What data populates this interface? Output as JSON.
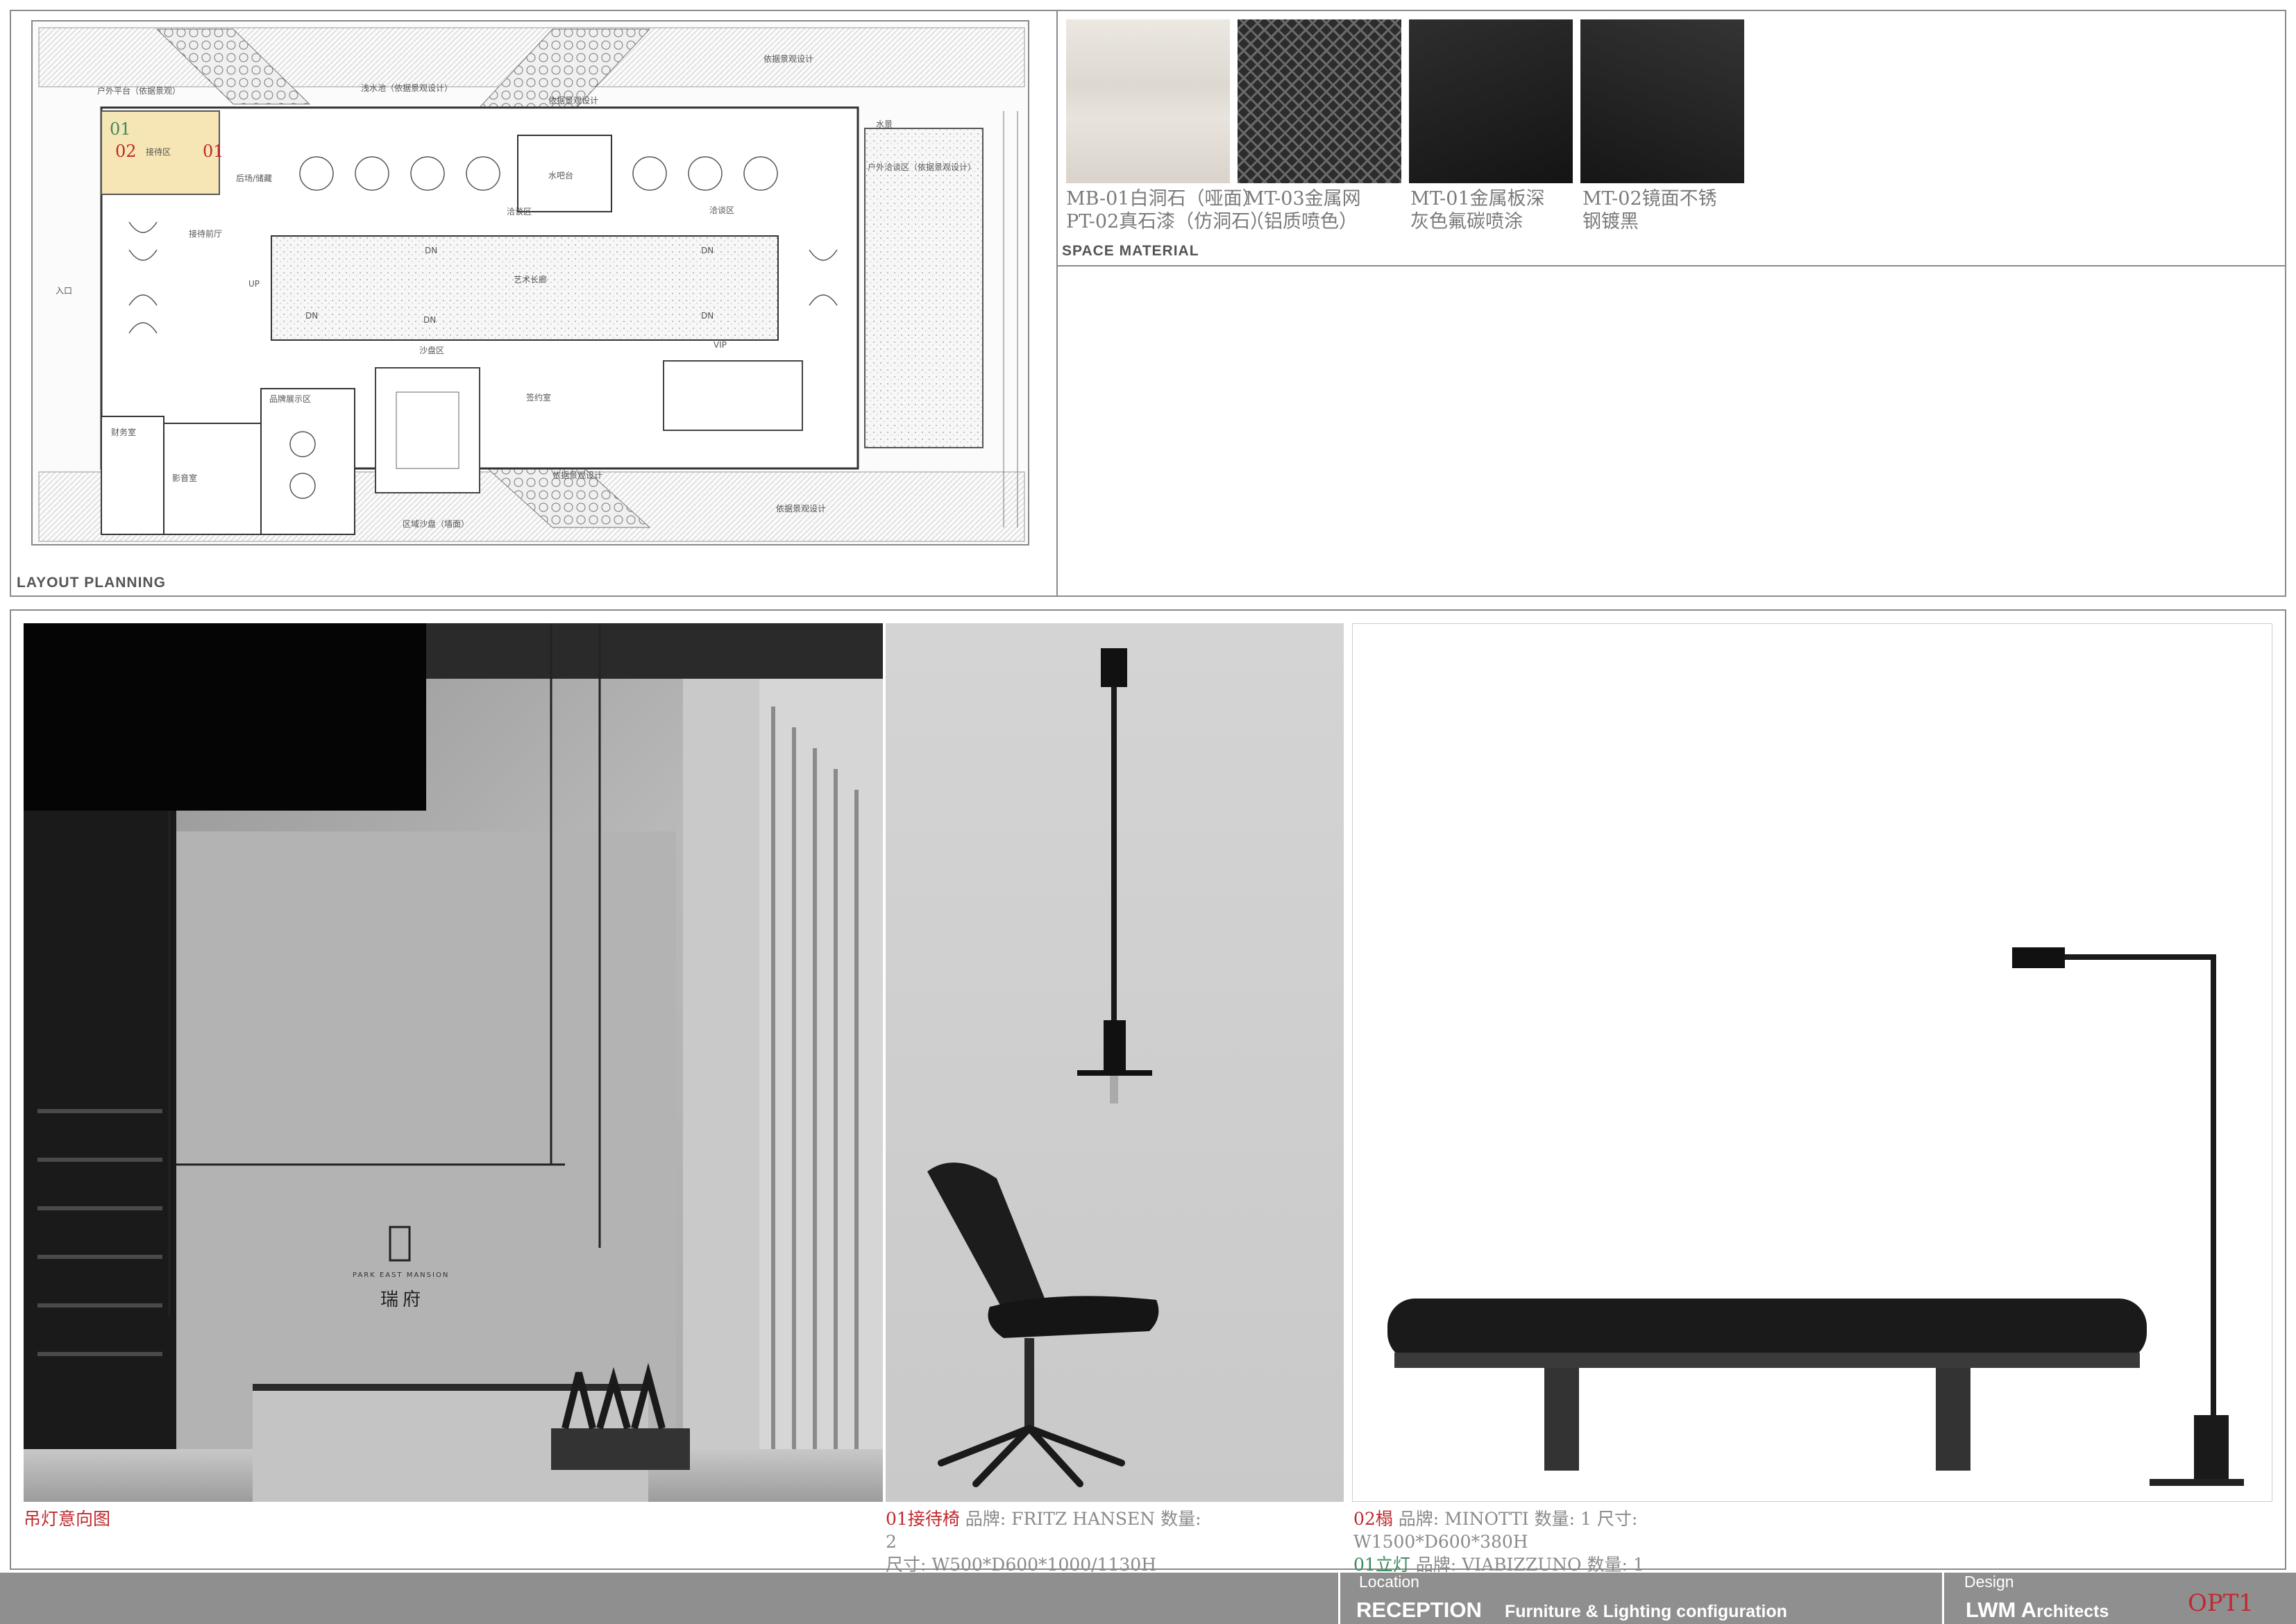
{
  "layout_planning": {
    "label": "LAYOUT PLANNING",
    "markers": {
      "m01_green": "01",
      "m02_red": "02",
      "m01_red": "01"
    },
    "rooms": [
      "户外平台（依据景观）",
      "浅水池（依据景观设计）",
      "依据景观设计",
      "依据景观设计",
      "接待区",
      "后场/储藏",
      "接待前厅",
      "洽谈区",
      "洽谈区",
      "水吧台",
      "户外洽谈区（依据景观设计）",
      "艺术长廊",
      "沙盘区",
      "品牌展示区",
      "签约室",
      "VIP",
      "财务室",
      "影音室",
      "依据景观设计",
      "区域沙盘（墙面）",
      "入口",
      "水景",
      "依据景观设计",
      "UP",
      "DN",
      "DN",
      "DN",
      "DN",
      "DN"
    ]
  },
  "space_material": {
    "label": "SPACE MATERIAL",
    "swatches": [
      {
        "name": "marble-swatch",
        "color": "#e6e1da"
      },
      {
        "name": "metal-mesh-swatch",
        "color": "#3a3a3a"
      },
      {
        "name": "dark-metal-panel-swatch",
        "color": "#1f1f1f"
      },
      {
        "name": "mirror-steel-swatch",
        "color": "#222222"
      }
    ],
    "items": [
      {
        "line1": "MB-01白洞石（哑面）",
        "line2": "PT-02真石漆（仿洞石）"
      },
      {
        "line1": "MT-03金属网",
        "line2": "（铝质喷色）"
      },
      {
        "line1": "MT-01金属板深",
        "line2": "灰色氟碳喷涂"
      },
      {
        "line1": "MT-02镜面不锈",
        "line2": "钢镀黑"
      }
    ]
  },
  "rendering": {
    "caption": "吊灯意向图",
    "logo_en": "PARK EAST MANSION",
    "logo_cn": "瑞府"
  },
  "chair": {
    "num": "01",
    "name": "接待椅",
    "line1_rest": " 品牌: FRITZ HANSEN   数量:",
    "line2": "2",
    "line3": "尺寸: W500*D600*1000/1130H"
  },
  "bench": {
    "num": "02",
    "name": "榻",
    "line1_rest": " 品牌: MINOTTI  数量: 1  尺寸:",
    "line2": "W1500*D600*380H",
    "line3_num": "01",
    "line3_name": "立灯",
    "line3_rest": " 品牌: VIABIZZUNO  数量: 1"
  },
  "footer": {
    "location_label": "Location",
    "title": "RECEPTION",
    "subtitle": "Furniture & Lighting configuration",
    "design_label": "Design",
    "firm_l": "LWM",
    "firm_a": "A",
    "firm_rest": "rchitects",
    "option": "OPT1"
  },
  "colors": {
    "accent_red": "#c0292e",
    "accent_green": "#3c8a5e",
    "footer_gray": "#8f8f8f"
  }
}
